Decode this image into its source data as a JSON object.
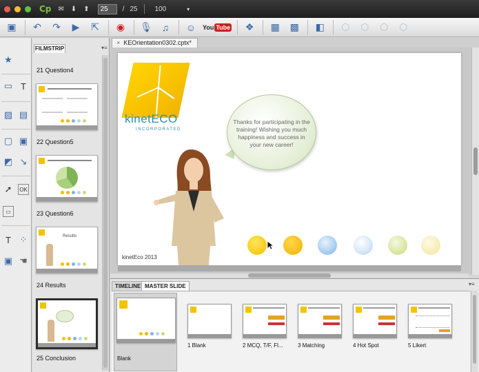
{
  "titlebar": {
    "app_logo": "Cp",
    "current_page": "25",
    "page_sep": "/",
    "total_pages": "25",
    "zoom": "100",
    "traffic_colors": [
      "#ee5b52",
      "#f5bd31",
      "#5bc43f"
    ]
  },
  "toolbar": {
    "youtube_text": "You",
    "youtube_badge": "Tube",
    "icons": [
      "save-icon",
      "undo-icon",
      "redo-icon",
      "preview-icon",
      "publish-icon",
      "record-icon",
      "microphone-icon",
      "music-icon",
      "character-icon",
      "youtube-icon",
      "widget-icon",
      "table-icon",
      "image-icon",
      "captivate-icon",
      "cube-icon"
    ]
  },
  "filmstrip": {
    "tab_label": "FILMSTRIP",
    "items": [
      {
        "label": "21 Question4"
      },
      {
        "label": "22 Question5"
      },
      {
        "label": "23 Question6"
      },
      {
        "label": "24 Results",
        "mini_title": "Results"
      },
      {
        "label": "25 Conclusion"
      }
    ]
  },
  "document": {
    "tab_label": "KEOrientation0302.cptx*",
    "close_glyph": "×"
  },
  "slide": {
    "brand_name": "kinetECO",
    "brand_sub": "INCORPORATED",
    "bubble_text": "Thanks for participating in the training! Wishing you much happiness and success in your new career!",
    "copyright": "kinetEco 2013",
    "dot_colors": [
      "#f4c000",
      "#f2b800",
      "#7fb4e6",
      "#b8d4f2",
      "#c9dc7a",
      "#f1e49a"
    ]
  },
  "bottom_panel": {
    "tabs": [
      "TIMELINE",
      "MASTER SLIDE"
    ],
    "master_label": "Blank",
    "layouts": [
      "1 Blank",
      "2 MCQ, T/F, Fl...",
      "3 Matching",
      "4 Hot Spot",
      "5 Likert"
    ]
  },
  "colors": {
    "accent_blue": "#3d6aa6",
    "brand_yellow": "#f2c400",
    "brand_teal": "#2b8fa8"
  }
}
